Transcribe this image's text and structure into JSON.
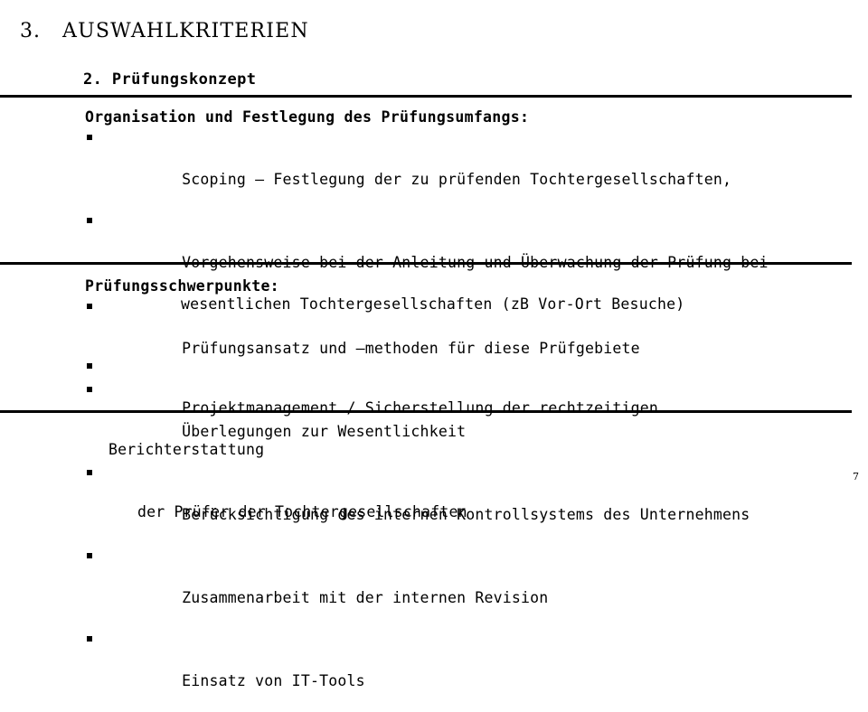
{
  "slide": {
    "title_number": "3.",
    "title_text": "AUSWAHLKRITERIEN",
    "subtitle": "2. Prüfungskonzept",
    "page_number": "7",
    "sections": [
      {
        "heading": "Organisation und Festlegung des Prüfungsumfangs:",
        "bullets": [
          {
            "text": "Scoping – Festlegung der zu prüfenden Tochtergesellschaften,",
            "extra_lines": []
          },
          {
            "text": "Vorgehensweise bei der Anleitung und Überwachung der Prüfung bei",
            "extra_lines": [
              {
                "text": "wesentlichen Tochtergesellschaften (zB Vor-Ort Besuche)",
                "indent": "center"
              }
            ]
          },
          {
            "text": "Projektmanagement / Sicherstellung der rechtzeitigen",
            "extra_lines": [
              {
                "text": "Berichterstattung",
                "indent": "none"
              },
              {
                "text": "der Prüfer der Tochtergesellschaften",
                "indent": "small"
              }
            ]
          }
        ]
      },
      {
        "heading": "Prüfungsschwerpunkte:",
        "bullets": [
          {
            "text": "Prüfungsansatz und –methoden für diese Prüfgebiete",
            "extra_lines": []
          },
          {
            "text": "Überlegungen zur Wesentlichkeit",
            "extra_lines": []
          },
          {
            "text": "Berücksichtigung des internen Kontrollsystems des Unternehmens",
            "extra_lines": []
          },
          {
            "text": "Zusammenarbeit mit der internen Revision",
            "extra_lines": []
          },
          {
            "text": "Einsatz von IT-Tools",
            "extra_lines": []
          }
        ]
      }
    ]
  }
}
